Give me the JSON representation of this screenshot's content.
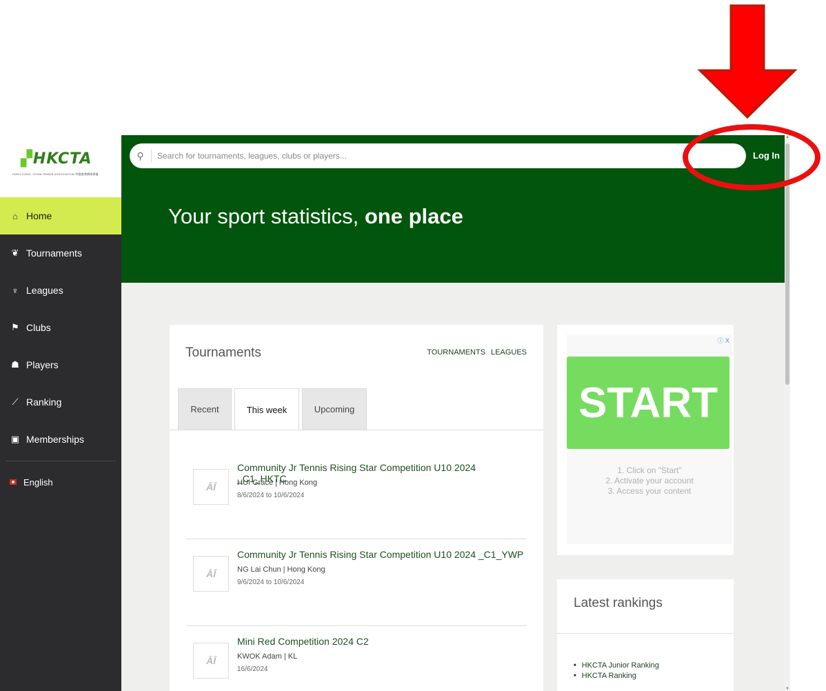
{
  "sidebar": {
    "logo": {
      "text_main": "HKCTA",
      "text_mark": "▞",
      "subtitle": "HONG KONG, CHINA TENNIS ASSOCIATION 中國香港網球總會"
    },
    "items": [
      {
        "label": "Home",
        "icon": "⌂"
      },
      {
        "label": "Tournaments",
        "icon": "❦"
      },
      {
        "label": "Leagues",
        "icon": "♆"
      },
      {
        "label": "Clubs",
        "icon": "⚑"
      },
      {
        "label": "Players",
        "icon": "☗"
      },
      {
        "label": "Ranking",
        "icon": "⟋"
      },
      {
        "label": "Memberships",
        "icon": "▣"
      }
    ],
    "language": "English"
  },
  "header": {
    "search_placeholder": "Search for tournaments, leagues, clubs or players...",
    "login_label": "Log In",
    "hero_title_regular": "Your sport statistics, ",
    "hero_title_bold": "one place"
  },
  "tournaments": {
    "title": "Tournaments",
    "links": [
      "TOURNAMENTS",
      "LEAGUES"
    ],
    "tabs": [
      "Recent",
      "This week",
      "Upcoming"
    ],
    "items": [
      {
        "name": "Community Jr Tennis Rising Star Competition U10 2024 _C1_HKTC",
        "meta": "HUI Grace | Hong Kong",
        "date": "8/6/2024 to 10/6/2024"
      },
      {
        "name": "Community Jr Tennis Rising Star Competition U10 2024 _C1_YWP",
        "meta": "NG Lai Chun | Hong Kong",
        "date": "9/6/2024 to 10/6/2024"
      },
      {
        "name": "Mini Red Competition 2024 C2",
        "meta": "KWOK Adam | KL",
        "date": "16/6/2024"
      }
    ]
  },
  "ad": {
    "close_label": "ⓘ X",
    "button_label": "START",
    "steps": [
      "1. Click on \"Start\"",
      "2. Activate your account",
      "3. Access your content"
    ]
  },
  "rankings": {
    "title": "Latest rankings",
    "items": [
      "HKCTA Junior Ranking",
      "HKCTA Ranking"
    ]
  },
  "colors": {
    "brand_green": "#02550c",
    "active_nav": "#d4eb4f",
    "sidebar_bg": "#2c2c2f",
    "annotation_red": "#ea1010"
  }
}
